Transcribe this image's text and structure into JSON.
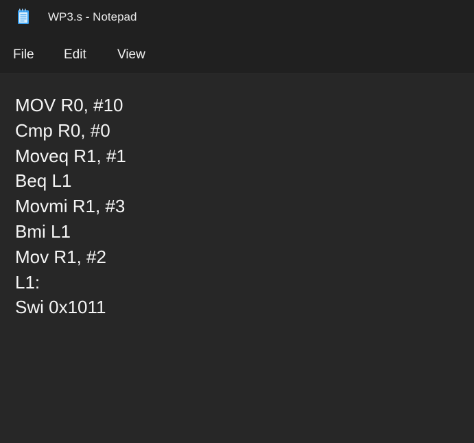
{
  "window": {
    "title": "WP3.s - Notepad",
    "icon": "notepad-icon"
  },
  "menu": {
    "file": "File",
    "edit": "Edit",
    "view": "View"
  },
  "editor": {
    "lines": [
      "MOV R0, #10",
      "Cmp R0, #0",
      "Moveq R1, #1",
      "Beq L1",
      "Movmi R1, #3",
      "Bmi L1",
      "Mov R1, #2",
      "L1:",
      "Swi 0x1011"
    ]
  },
  "colors": {
    "titlebar": "#202020",
    "editor_background": "#272727",
    "text": "#f5f5f5",
    "icon_accent": "#3aa0f0"
  }
}
